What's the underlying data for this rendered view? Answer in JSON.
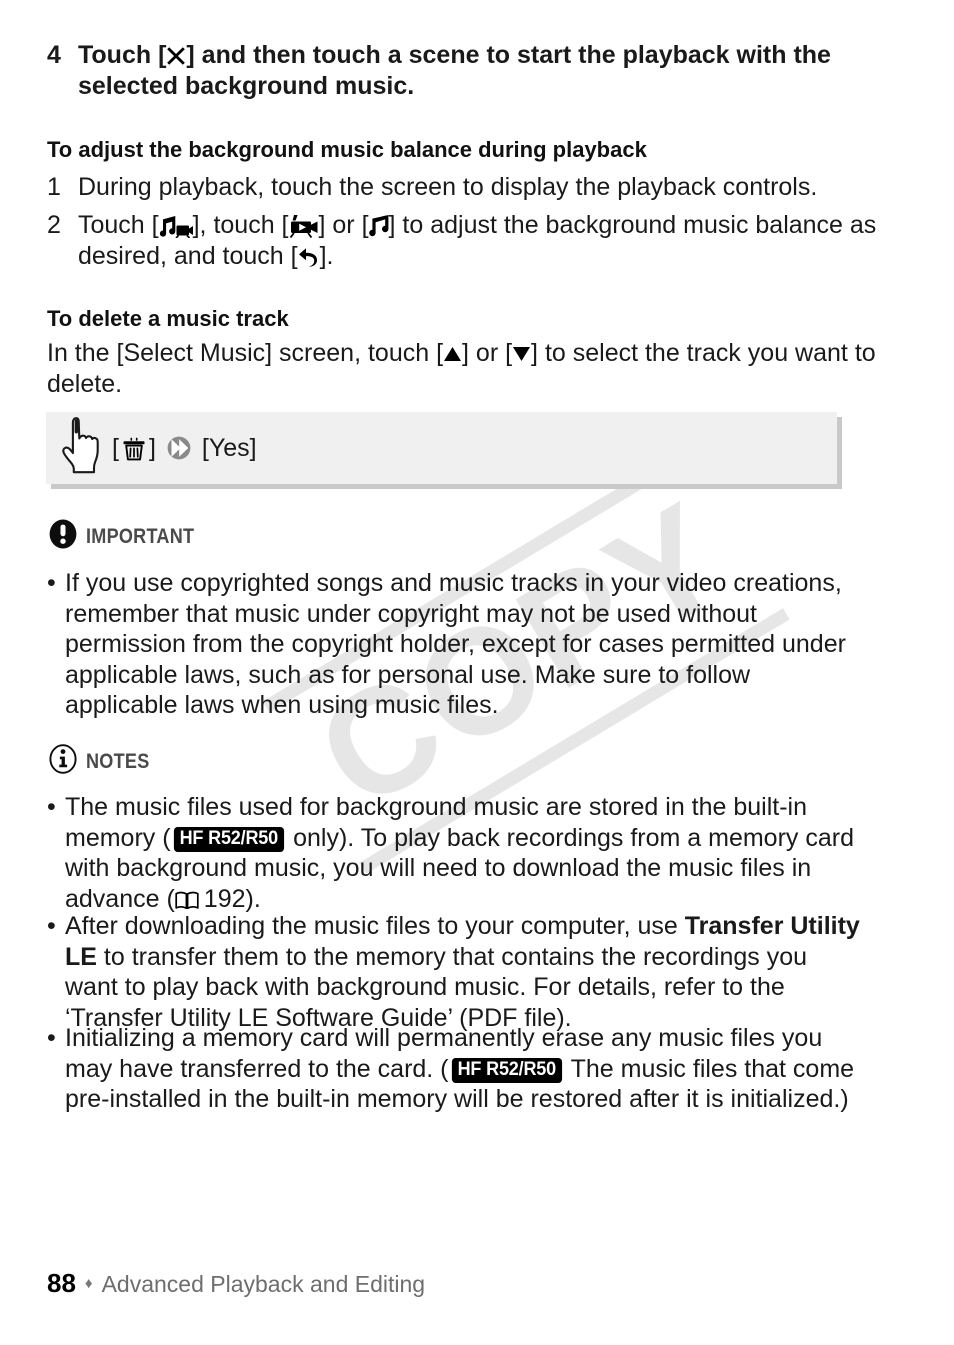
{
  "watermark": {
    "text": "COPY"
  },
  "steps": [
    {
      "number": "4",
      "text_before": "Touch [",
      "icon": "close-x-icon",
      "text_after": "] and then touch a scene to start the playback with the selected background music."
    }
  ],
  "section_balance": {
    "heading": "To adjust the background music balance during playback",
    "step1": {
      "number": "1",
      "text": "During playback, touch the screen to display the playback controls."
    },
    "step2": {
      "number": "2",
      "part1": "Touch [",
      "icon1": "music-video-balance-icon",
      "part2": "], touch [",
      "icon2": "video-movie-icon",
      "part3": "] or [",
      "icon3": "music-note-icon",
      "part4": "] to adjust the background music balance as desired, and touch [",
      "icon4": "return-back-arrow-icon",
      "part5": "]."
    }
  },
  "section_delete": {
    "heading": "To delete a music track",
    "part1": "In the [Select Music] screen, touch [",
    "icon_up": "triangle-up-icon",
    "part2": "] or [",
    "icon_down": "triangle-down-icon",
    "part3": "] to select the track you want to delete."
  },
  "procedure_box": {
    "hand_icon": "pointing-hand-icon",
    "bracket_open": "[",
    "trash_icon": "trash-delete-icon",
    "bracket_close": "]",
    "arrow_icon": "double-chevron-right-icon",
    "result": "[Yes]"
  },
  "important": {
    "icon": "exclamation-circle-icon",
    "label": "IMPORTANT",
    "bullets": [
      {
        "marker": "•",
        "text": "If you use copyrighted songs and music tracks in your video creations, remember that music under copyright may not be used without permission from the copyright holder, except for cases permitted under applicable laws, such as for personal use. Make sure to follow applicable laws when using music files."
      }
    ]
  },
  "notes": {
    "icon": "info-circle-icon",
    "label": "NOTES",
    "bullet1": {
      "marker": "•",
      "part1": "The music files used for background music are stored in the built-in memory (",
      "badge": "HF R52/R50",
      "part2": " only). To play back recordings from a memory card with background music, you will need to download the music files in advance (",
      "book_icon": "open-book-icon",
      "page_ref": "192",
      "part3": ")."
    },
    "bullet2": {
      "marker": "•",
      "part1": "After downloading the music files to your computer, use ",
      "bold1": "Transfer Utility LE",
      "part2": " to transfer them to the memory that contains the recordings you want to play back with background music. For details, refer to the ‘Transfer Utility LE Software Guide’ (PDF file)."
    },
    "bullet3": {
      "marker": "•",
      "part1": "Initializing a memory card will permanently erase any music files you may have transferred to the card. (",
      "badge": "HF R52/R50",
      "part2": " The music files that come pre-installed in the built-in memory will be restored after it is initialized.)"
    }
  },
  "footer": {
    "page_number": "88",
    "separator": "♦",
    "chapter": "Advanced Playback and Editing"
  },
  "colors": {
    "text": "#1a1a1a",
    "callout_label": "#4a4a4a",
    "box_fill": "#f0f0f0",
    "box_shadow": "#c9c9c9",
    "watermark": "#e6e6e6",
    "footer_gray": "#6e6e6e"
  }
}
